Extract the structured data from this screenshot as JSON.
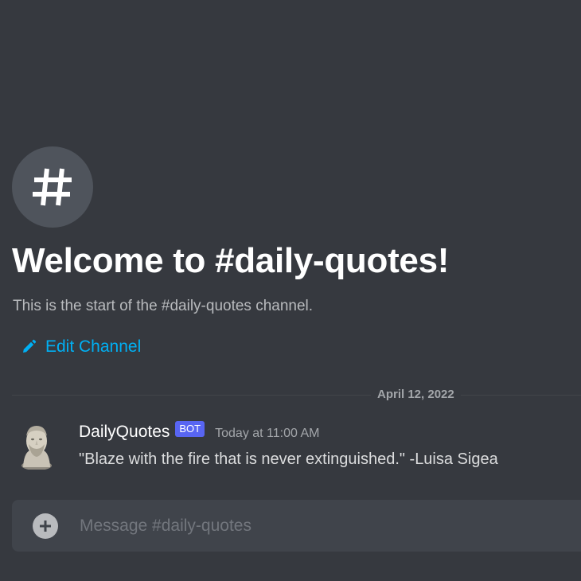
{
  "channel": {
    "icon": "hashtag-icon",
    "welcome_title": "Welcome to #daily-quotes!",
    "welcome_subtitle": "This is the start of the #daily-quotes channel.",
    "edit_label": "Edit Channel"
  },
  "divider": {
    "date": "April 12, 2022"
  },
  "message": {
    "avatar": "bust-avatar",
    "username": "DailyQuotes",
    "bot_tag": "BOT",
    "timestamp": "Today at 11:00 AM",
    "content": "\"Blaze with the fire that is never extinguished.\" -Luisa Sigea"
  },
  "composer": {
    "add_icon": "plus-circle-icon",
    "placeholder": "Message #daily-quotes",
    "value": ""
  },
  "colors": {
    "background": "#36393f",
    "link": "#00b0f4",
    "bot_tag": "#5865f2",
    "composer": "#40444b"
  }
}
